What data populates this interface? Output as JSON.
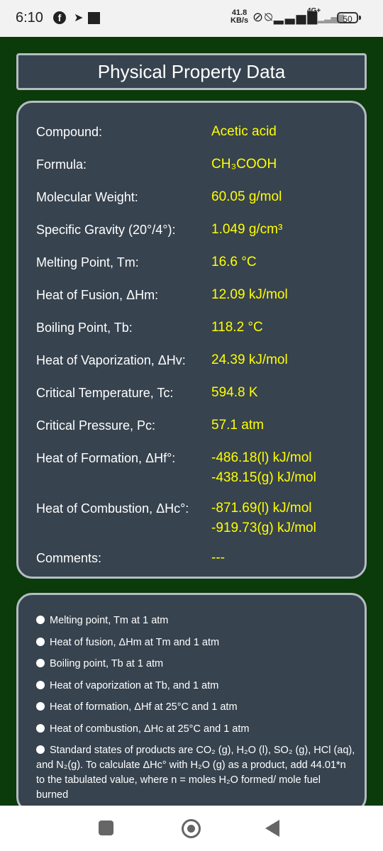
{
  "status_bar": {
    "time": "6:10",
    "speed_value": "41.8",
    "speed_unit": "KB/s",
    "network": "4G+",
    "battery": "50"
  },
  "title": "Physical Property Data",
  "properties": [
    {
      "label": "Compound:",
      "value": "Acetic acid"
    },
    {
      "label": "Formula:",
      "value": "CH₃COOH"
    },
    {
      "label": "Molecular Weight:",
      "value": "60.05 g/mol"
    },
    {
      "label": "Specific Gravity  (20°/4°):",
      "value": "1.049 g/cm³"
    },
    {
      "label": "Melting Point, Tm:",
      "value": "16.6 °C"
    },
    {
      "label": "Heat of Fusion, ΔHm:",
      "value": "12.09 kJ/mol"
    },
    {
      "label": "Boiling Point, Tb:",
      "value": "118.2 °C"
    },
    {
      "label": "Heat of Vaporization, ΔHv:",
      "value": "24.39 kJ/mol"
    },
    {
      "label": "Critical Temperature, Tc:",
      "value": "594.8 K"
    },
    {
      "label": "Critical Pressure, Pc:",
      "value": "57.1 atm"
    },
    {
      "label": "Heat of Formation, ΔHf°:",
      "value": "-486.18(l) kJ/mol",
      "value2": "-438.15(g) kJ/mol"
    },
    {
      "label": "Heat of Combustion, ΔHc°:",
      "value": "-871.69(l) kJ/mol",
      "value2": "-919.73(g) kJ/mol"
    },
    {
      "label": "Comments:",
      "value": "---"
    }
  ],
  "notes": [
    "Melting point, Tm at 1 atm",
    "Heat of fusion, ΔHm at Tm and 1 atm",
    "Boiling point, Tb at 1 atm",
    "Heat of vaporization at Tb, and 1 atm",
    "Heat of formation, ΔHf at 25°C and 1 atm",
    "Heat of combustion, ΔHc at 25°C and 1 atm",
    "Standard states of products are CO₂ (g), H₂O (l), SO₂ (g), HCl (aq), and N₂(g). To calculate ΔHc° with H₂O (g) as a product, add 44.01*n to the tabulated value, where n = moles H₂O formed/ mole fuel burned"
  ]
}
